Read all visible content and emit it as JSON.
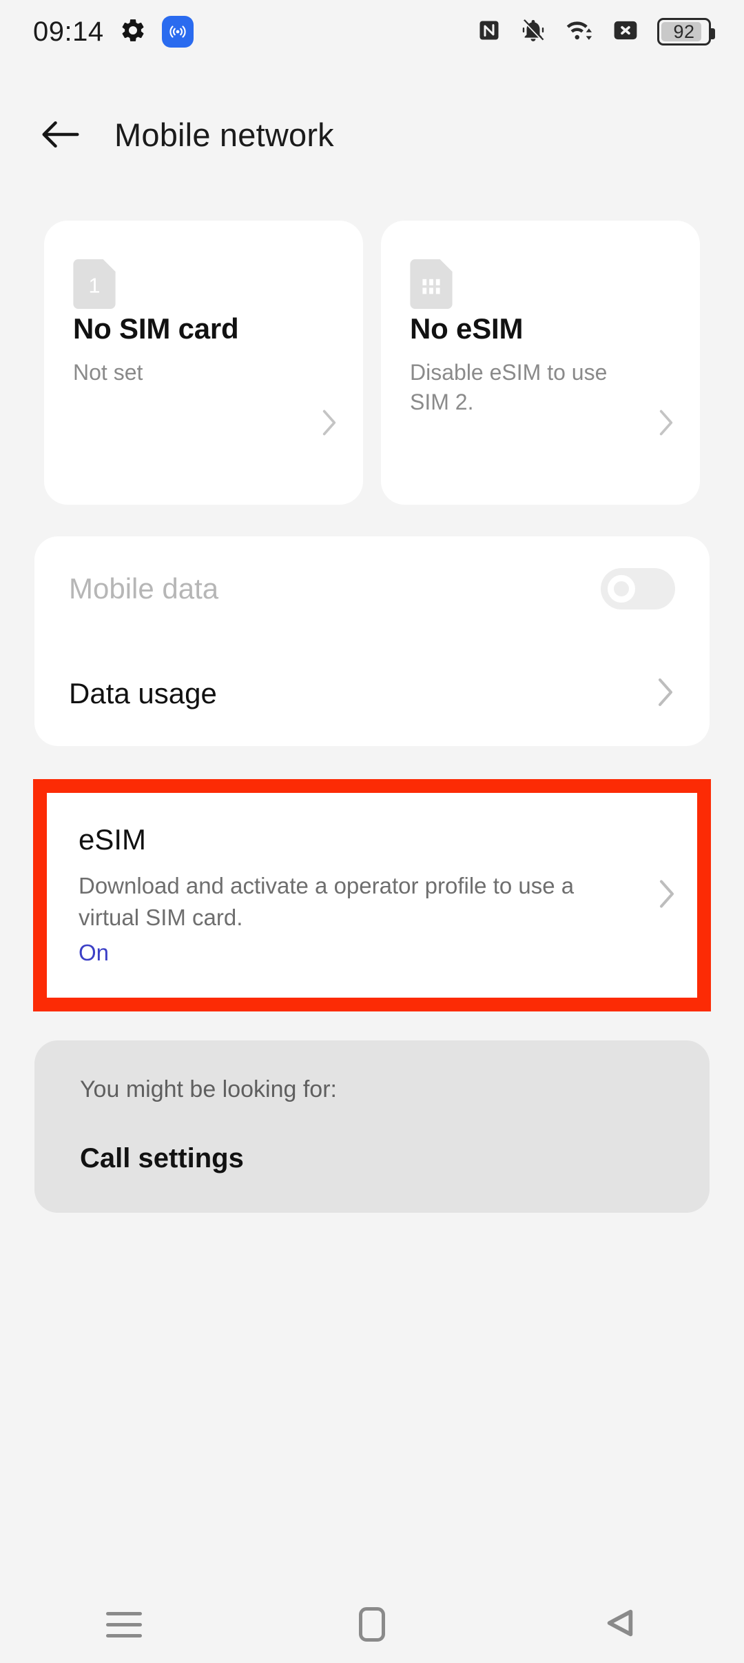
{
  "status_bar": {
    "time": "09:14",
    "icons_left": [
      "gear-icon",
      "hotspot-icon"
    ],
    "icons_right": [
      "nfc-icon",
      "ringer-muted-icon",
      "wifi-icon",
      "no-sim-icon"
    ],
    "battery_level": "92"
  },
  "header": {
    "back_label": "Back",
    "title": "Mobile network"
  },
  "sim_cards": [
    {
      "icon": "sim-card-1-icon",
      "icon_badge": "1",
      "title": "No SIM card",
      "subtitle": "Not set",
      "chevron": "chevron-right-icon"
    },
    {
      "icon": "esim-chip-icon",
      "icon_badge": "",
      "title": "No eSIM",
      "subtitle": "Disable eSIM to use SIM 2.",
      "chevron": "chevron-right-icon"
    }
  ],
  "settings_panel": {
    "mobile_data": {
      "label": "Mobile data",
      "enabled": false,
      "toggle_state": "off"
    },
    "data_usage": {
      "label": "Data usage",
      "chevron": "chevron-right-icon"
    }
  },
  "esim_section": {
    "highlighted": true,
    "highlight_color": "#FC2B05",
    "title": "eSIM",
    "description": "Download and activate a operator profile to use a virtual SIM card.",
    "state": "On",
    "state_color": "#3B3FC6",
    "chevron": "chevron-right-icon"
  },
  "suggestions": {
    "heading": "You might be looking for:",
    "items": [
      "Call settings"
    ]
  },
  "nav_bar": {
    "recents_label": "Recents",
    "home_label": "Home",
    "back_label": "Back"
  }
}
